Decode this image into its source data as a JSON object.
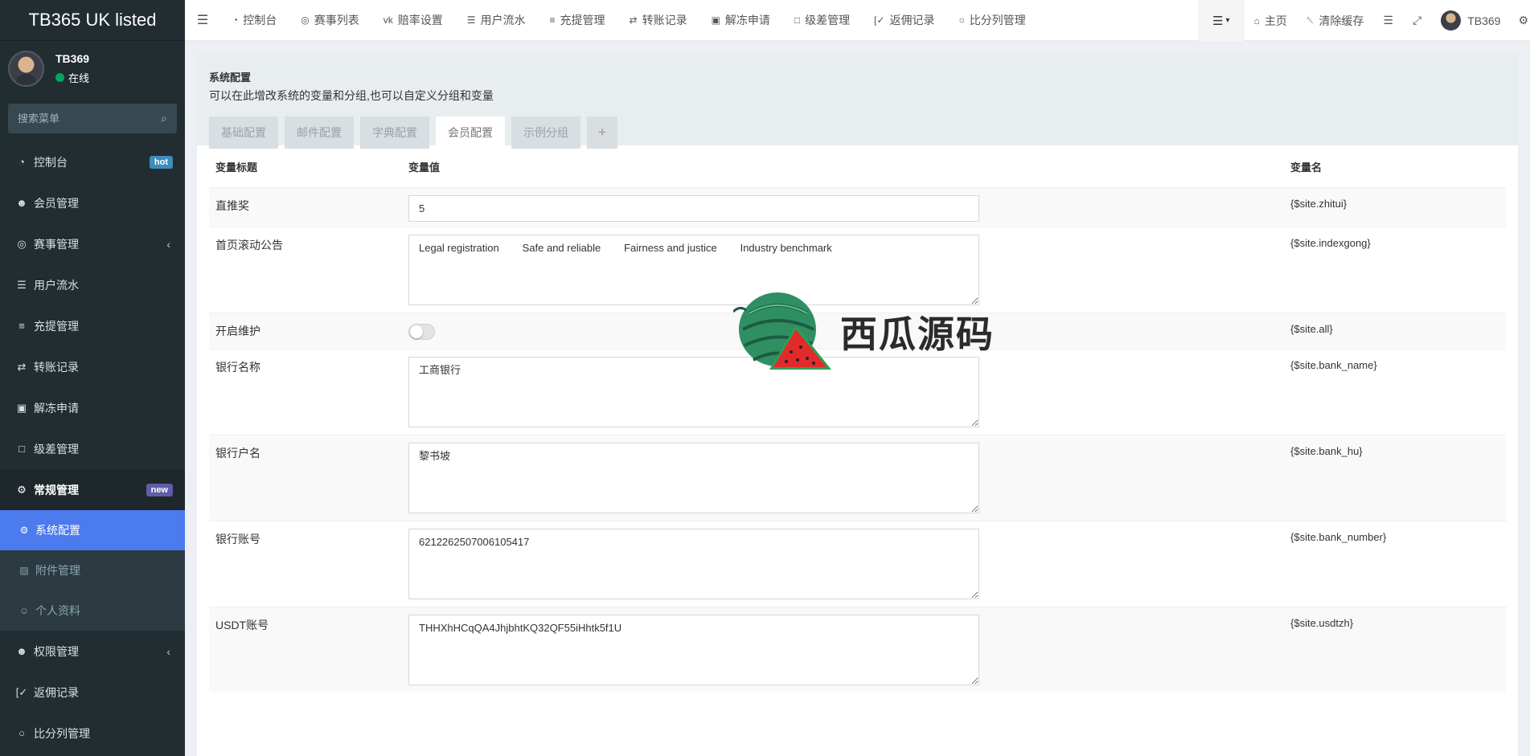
{
  "app": {
    "title": "TB365 UK listed"
  },
  "user": {
    "name": "TB369",
    "status": "在线"
  },
  "search": {
    "placeholder": "搜索菜单"
  },
  "sidebar": {
    "items": [
      {
        "label": "控制台",
        "badge": "hot"
      },
      {
        "label": "会员管理"
      },
      {
        "label": "赛事管理"
      },
      {
        "label": "用户流水"
      },
      {
        "label": "充提管理"
      },
      {
        "label": "转账记录"
      },
      {
        "label": "解冻申请"
      },
      {
        "label": "级差管理"
      },
      {
        "label": "常规管理",
        "badge": "new"
      },
      {
        "label": "权限管理"
      },
      {
        "label": "返佣记录"
      },
      {
        "label": "比分列管理"
      }
    ],
    "sub_items": [
      {
        "label": "系统配置"
      },
      {
        "label": "附件管理"
      },
      {
        "label": "个人资料"
      }
    ]
  },
  "topnav": {
    "items": [
      "控制台",
      "赛事列表",
      "赔率设置",
      "用户流水",
      "充提管理",
      "转账记录",
      "解冻申请",
      "级差管理",
      "返佣记录",
      "比分列管理"
    ],
    "home": "主页",
    "clear_cache": "清除缓存",
    "username": "TB369"
  },
  "panel": {
    "title": "系统配置",
    "description": "可以在此增改系统的变量和分组,也可以自定义分组和变量",
    "tabs": [
      "基础配置",
      "邮件配置",
      "字典配置",
      "会员配置",
      "示例分组",
      "+"
    ],
    "active_tab": "会员配置"
  },
  "table": {
    "headers": [
      "变量标题",
      "变量值",
      "变量名"
    ],
    "rows": [
      {
        "title": "直推奖",
        "type": "input",
        "value": "5",
        "name": "{$site.zhitui}"
      },
      {
        "title": "首页滚动公告",
        "type": "textarea",
        "value": "Legal registration        Safe and reliable        Fairness and justice        Industry benchmark",
        "name": "{$site.indexgong}"
      },
      {
        "title": "开启维护",
        "type": "toggle",
        "value": "off",
        "name": "{$site.all}"
      },
      {
        "title": "银行名称",
        "type": "textarea",
        "value": "工商银行",
        "name": "{$site.bank_name}"
      },
      {
        "title": "银行户名",
        "type": "textarea",
        "value": "黎书坡",
        "name": "{$site.bank_hu}"
      },
      {
        "title": "银行账号",
        "type": "textarea",
        "value": "6212262507006105417",
        "name": "{$site.bank_number}"
      },
      {
        "title": "USDT账号",
        "type": "textarea",
        "value": "THHXhHCqQA4JhjbhtKQ32QF55iHhtk5f1U",
        "name": "{$site.usdtzh}"
      }
    ]
  },
  "watermark": {
    "text": "西瓜源码"
  },
  "colors": {
    "sidebar_bg": "#222d32",
    "active_blue": "#4b7bec",
    "badge_hot": "#3c8dbc",
    "badge_new": "#605ca8",
    "online": "#00a65a"
  }
}
